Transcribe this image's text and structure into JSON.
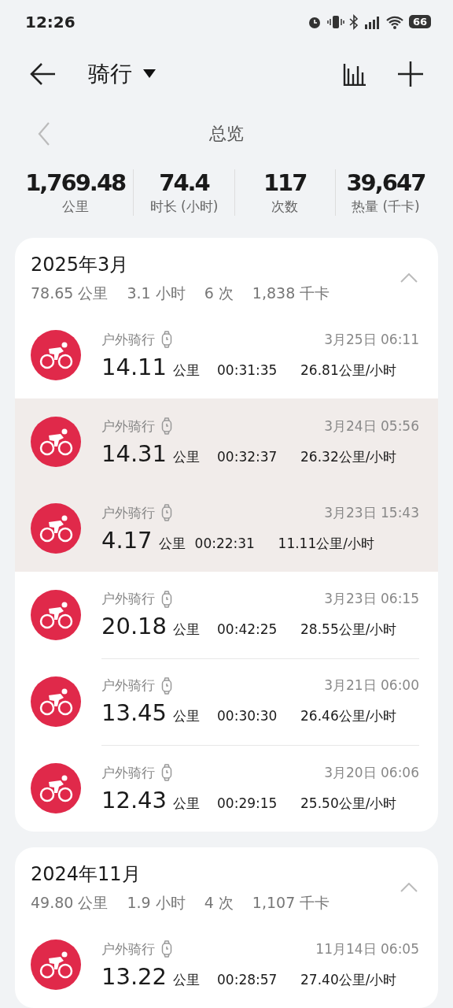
{
  "status_bar": {
    "time": "12:26",
    "battery": "66"
  },
  "header": {
    "title": "骑行"
  },
  "overview": {
    "title": "总览"
  },
  "totals": [
    {
      "value": "1,769.48",
      "label": "公里"
    },
    {
      "value": "74.4",
      "label": "时长 (小时)"
    },
    {
      "value": "117",
      "label": "次数"
    },
    {
      "value": "39,647",
      "label": "热量 (千卡)"
    }
  ],
  "months": [
    {
      "title": "2025年3月",
      "expanded": true,
      "summary": [
        "78.65 公里",
        "3.1 小时",
        "6 次",
        "1,838 千卡"
      ],
      "records": [
        {
          "type": "户外骑行",
          "date": "3月25日 06:11",
          "distance": "14.11",
          "unit": "公里",
          "duration": "00:31:35",
          "speed": "26.81公里/小时",
          "selected": false
        },
        {
          "type": "户外骑行",
          "date": "3月24日 05:56",
          "distance": "14.31",
          "unit": "公里",
          "duration": "00:32:37",
          "speed": "26.32公里/小时",
          "selected": true
        },
        {
          "type": "户外骑行",
          "date": "3月23日 15:43",
          "distance": "4.17",
          "unit": "公里",
          "duration": "00:22:31",
          "speed": "11.11公里/小时",
          "selected": true
        },
        {
          "type": "户外骑行",
          "date": "3月23日 06:15",
          "distance": "20.18",
          "unit": "公里",
          "duration": "00:42:25",
          "speed": "28.55公里/小时",
          "selected": false
        },
        {
          "type": "户外骑行",
          "date": "3月21日 06:00",
          "distance": "13.45",
          "unit": "公里",
          "duration": "00:30:30",
          "speed": "26.46公里/小时",
          "selected": false
        },
        {
          "type": "户外骑行",
          "date": "3月20日 06:06",
          "distance": "12.43",
          "unit": "公里",
          "duration": "00:29:15",
          "speed": "25.50公里/小时",
          "selected": false
        }
      ]
    },
    {
      "title": "2024年11月",
      "expanded": true,
      "summary": [
        "49.80 公里",
        "1.9 小时",
        "4 次",
        "1,107 千卡"
      ],
      "records": [
        {
          "type": "户外骑行",
          "date": "11月14日 06:05",
          "distance": "13.22",
          "unit": "公里",
          "duration": "00:28:57",
          "speed": "27.40公里/小时",
          "selected": false
        }
      ]
    }
  ]
}
